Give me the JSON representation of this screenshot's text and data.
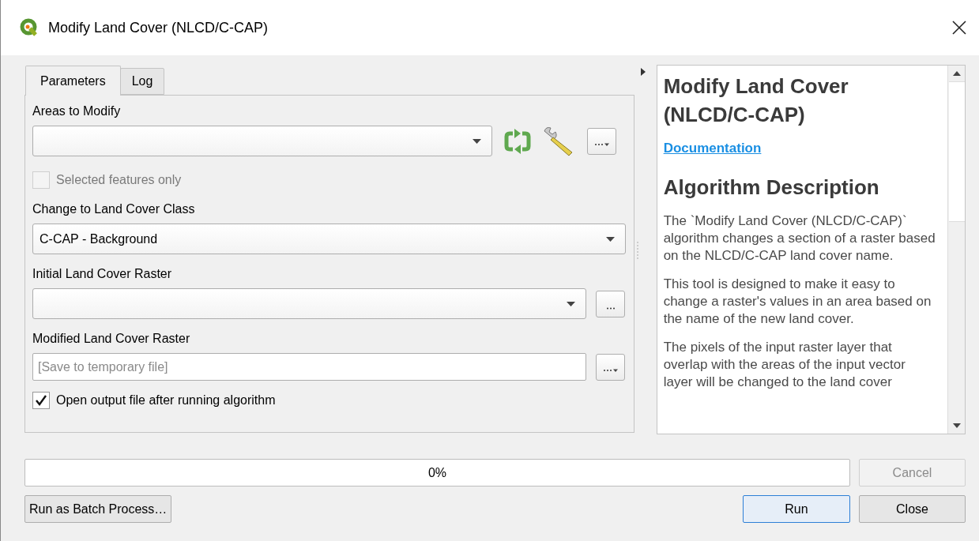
{
  "window": {
    "title": "Modify Land Cover (NLCD/C-CAP)"
  },
  "tabs": [
    {
      "label": "Parameters",
      "selected": true
    },
    {
      "label": "Log",
      "selected": false
    }
  ],
  "parameters": [
    {
      "kind": "label",
      "text": "Areas to Modify"
    },
    {
      "kind": "layer",
      "tools": true
    },
    {
      "kind": "checkbox",
      "text": "Selected features only",
      "checked": false,
      "disabled": true
    },
    {
      "kind": "label",
      "text": "Change to Land Cover Class"
    },
    {
      "kind": "combo",
      "value": "C-CAP - Background"
    },
    {
      "kind": "label",
      "text": "Initial Land Cover Raster"
    },
    {
      "kind": "layer",
      "tools": false
    },
    {
      "kind": "label",
      "text": "Modified Land Cover Raster"
    },
    {
      "kind": "output",
      "placeholder": "[Save to temporary file]"
    },
    {
      "kind": "checkbox",
      "text": "Open output file after running algorithm",
      "checked": true,
      "disabled": false
    }
  ],
  "help": [
    {
      "kind": "title",
      "text": "Modify Land Cover (NLCD/C-CAP)"
    },
    {
      "kind": "link",
      "text": "Documentation"
    },
    {
      "kind": "heading",
      "text": "Algorithm Description"
    },
    {
      "kind": "paragraph",
      "text": "The `Modify Land Cover (NLCD/C-CAP)` algorithm changes a section of a raster based on the NLCD/C-CAP land cover name."
    },
    {
      "kind": "paragraph",
      "text": "This tool is designed to make it easy to change a raster's values in an area based on the name of the new land cover."
    },
    {
      "kind": "paragraph",
      "text": "The pixels of the input raster layer that overlap with the areas of the input vector layer will be changed to the land cover"
    }
  ],
  "progress": {
    "level": 0,
    "text": "0%"
  },
  "buttons": [
    {
      "kind": "cancel",
      "label": "Cancel",
      "disabled": true
    },
    {
      "kind": "batch",
      "label": "Run as Batch Process…",
      "disabled": false
    },
    {
      "kind": "run",
      "label": "Run",
      "disabled": false
    },
    {
      "kind": "close",
      "label": "Close",
      "disabled": false
    }
  ]
}
